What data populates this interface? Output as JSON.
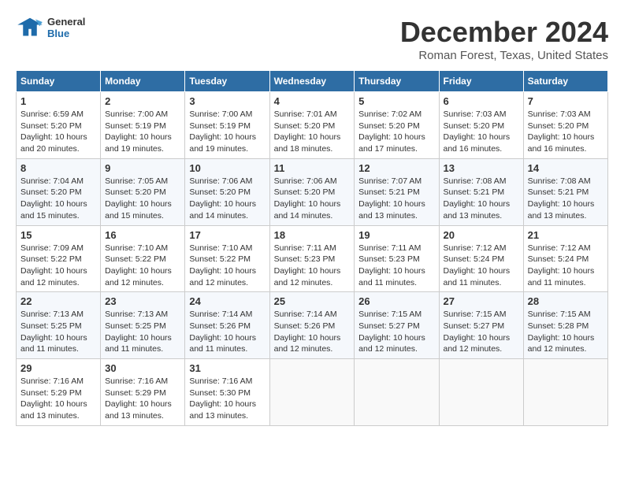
{
  "header": {
    "logo_line1": "General",
    "logo_line2": "Blue",
    "month": "December 2024",
    "location": "Roman Forest, Texas, United States"
  },
  "weekdays": [
    "Sunday",
    "Monday",
    "Tuesday",
    "Wednesday",
    "Thursday",
    "Friday",
    "Saturday"
  ],
  "weeks": [
    [
      {
        "day": "1",
        "sunrise": "Sunrise: 6:59 AM",
        "sunset": "Sunset: 5:20 PM",
        "daylight": "Daylight: 10 hours and 20 minutes."
      },
      {
        "day": "2",
        "sunrise": "Sunrise: 7:00 AM",
        "sunset": "Sunset: 5:19 PM",
        "daylight": "Daylight: 10 hours and 19 minutes."
      },
      {
        "day": "3",
        "sunrise": "Sunrise: 7:00 AM",
        "sunset": "Sunset: 5:19 PM",
        "daylight": "Daylight: 10 hours and 19 minutes."
      },
      {
        "day": "4",
        "sunrise": "Sunrise: 7:01 AM",
        "sunset": "Sunset: 5:20 PM",
        "daylight": "Daylight: 10 hours and 18 minutes."
      },
      {
        "day": "5",
        "sunrise": "Sunrise: 7:02 AM",
        "sunset": "Sunset: 5:20 PM",
        "daylight": "Daylight: 10 hours and 17 minutes."
      },
      {
        "day": "6",
        "sunrise": "Sunrise: 7:03 AM",
        "sunset": "Sunset: 5:20 PM",
        "daylight": "Daylight: 10 hours and 16 minutes."
      },
      {
        "day": "7",
        "sunrise": "Sunrise: 7:03 AM",
        "sunset": "Sunset: 5:20 PM",
        "daylight": "Daylight: 10 hours and 16 minutes."
      }
    ],
    [
      {
        "day": "8",
        "sunrise": "Sunrise: 7:04 AM",
        "sunset": "Sunset: 5:20 PM",
        "daylight": "Daylight: 10 hours and 15 minutes."
      },
      {
        "day": "9",
        "sunrise": "Sunrise: 7:05 AM",
        "sunset": "Sunset: 5:20 PM",
        "daylight": "Daylight: 10 hours and 15 minutes."
      },
      {
        "day": "10",
        "sunrise": "Sunrise: 7:06 AM",
        "sunset": "Sunset: 5:20 PM",
        "daylight": "Daylight: 10 hours and 14 minutes."
      },
      {
        "day": "11",
        "sunrise": "Sunrise: 7:06 AM",
        "sunset": "Sunset: 5:20 PM",
        "daylight": "Daylight: 10 hours and 14 minutes."
      },
      {
        "day": "12",
        "sunrise": "Sunrise: 7:07 AM",
        "sunset": "Sunset: 5:21 PM",
        "daylight": "Daylight: 10 hours and 13 minutes."
      },
      {
        "day": "13",
        "sunrise": "Sunrise: 7:08 AM",
        "sunset": "Sunset: 5:21 PM",
        "daylight": "Daylight: 10 hours and 13 minutes."
      },
      {
        "day": "14",
        "sunrise": "Sunrise: 7:08 AM",
        "sunset": "Sunset: 5:21 PM",
        "daylight": "Daylight: 10 hours and 13 minutes."
      }
    ],
    [
      {
        "day": "15",
        "sunrise": "Sunrise: 7:09 AM",
        "sunset": "Sunset: 5:22 PM",
        "daylight": "Daylight: 10 hours and 12 minutes."
      },
      {
        "day": "16",
        "sunrise": "Sunrise: 7:10 AM",
        "sunset": "Sunset: 5:22 PM",
        "daylight": "Daylight: 10 hours and 12 minutes."
      },
      {
        "day": "17",
        "sunrise": "Sunrise: 7:10 AM",
        "sunset": "Sunset: 5:22 PM",
        "daylight": "Daylight: 10 hours and 12 minutes."
      },
      {
        "day": "18",
        "sunrise": "Sunrise: 7:11 AM",
        "sunset": "Sunset: 5:23 PM",
        "daylight": "Daylight: 10 hours and 12 minutes."
      },
      {
        "day": "19",
        "sunrise": "Sunrise: 7:11 AM",
        "sunset": "Sunset: 5:23 PM",
        "daylight": "Daylight: 10 hours and 11 minutes."
      },
      {
        "day": "20",
        "sunrise": "Sunrise: 7:12 AM",
        "sunset": "Sunset: 5:24 PM",
        "daylight": "Daylight: 10 hours and 11 minutes."
      },
      {
        "day": "21",
        "sunrise": "Sunrise: 7:12 AM",
        "sunset": "Sunset: 5:24 PM",
        "daylight": "Daylight: 10 hours and 11 minutes."
      }
    ],
    [
      {
        "day": "22",
        "sunrise": "Sunrise: 7:13 AM",
        "sunset": "Sunset: 5:25 PM",
        "daylight": "Daylight: 10 hours and 11 minutes."
      },
      {
        "day": "23",
        "sunrise": "Sunrise: 7:13 AM",
        "sunset": "Sunset: 5:25 PM",
        "daylight": "Daylight: 10 hours and 11 minutes."
      },
      {
        "day": "24",
        "sunrise": "Sunrise: 7:14 AM",
        "sunset": "Sunset: 5:26 PM",
        "daylight": "Daylight: 10 hours and 11 minutes."
      },
      {
        "day": "25",
        "sunrise": "Sunrise: 7:14 AM",
        "sunset": "Sunset: 5:26 PM",
        "daylight": "Daylight: 10 hours and 12 minutes."
      },
      {
        "day": "26",
        "sunrise": "Sunrise: 7:15 AM",
        "sunset": "Sunset: 5:27 PM",
        "daylight": "Daylight: 10 hours and 12 minutes."
      },
      {
        "day": "27",
        "sunrise": "Sunrise: 7:15 AM",
        "sunset": "Sunset: 5:27 PM",
        "daylight": "Daylight: 10 hours and 12 minutes."
      },
      {
        "day": "28",
        "sunrise": "Sunrise: 7:15 AM",
        "sunset": "Sunset: 5:28 PM",
        "daylight": "Daylight: 10 hours and 12 minutes."
      }
    ],
    [
      {
        "day": "29",
        "sunrise": "Sunrise: 7:16 AM",
        "sunset": "Sunset: 5:29 PM",
        "daylight": "Daylight: 10 hours and 13 minutes."
      },
      {
        "day": "30",
        "sunrise": "Sunrise: 7:16 AM",
        "sunset": "Sunset: 5:29 PM",
        "daylight": "Daylight: 10 hours and 13 minutes."
      },
      {
        "day": "31",
        "sunrise": "Sunrise: 7:16 AM",
        "sunset": "Sunset: 5:30 PM",
        "daylight": "Daylight: 10 hours and 13 minutes."
      },
      {
        "day": "",
        "sunrise": "",
        "sunset": "",
        "daylight": ""
      },
      {
        "day": "",
        "sunrise": "",
        "sunset": "",
        "daylight": ""
      },
      {
        "day": "",
        "sunrise": "",
        "sunset": "",
        "daylight": ""
      },
      {
        "day": "",
        "sunrise": "",
        "sunset": "",
        "daylight": ""
      }
    ]
  ]
}
